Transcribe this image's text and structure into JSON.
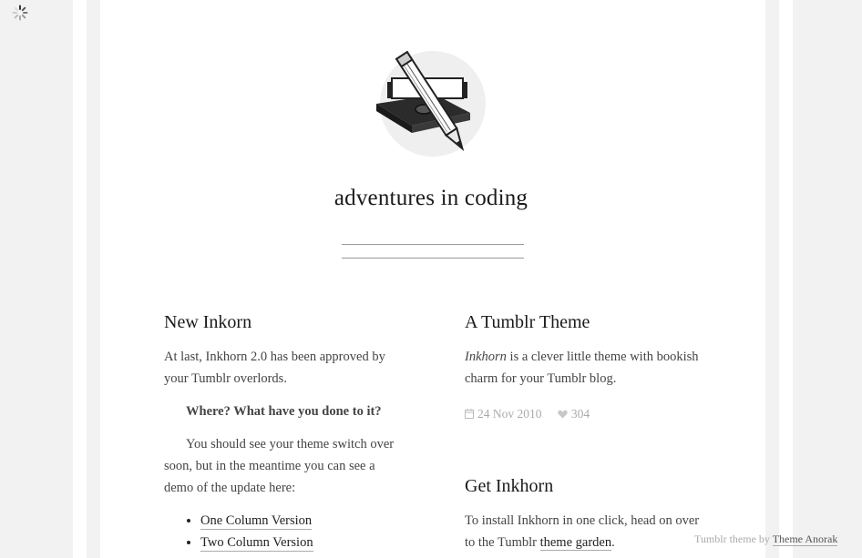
{
  "site": {
    "title": "adventures in coding"
  },
  "posts_left": {
    "title": "New Inkorn",
    "intro": "At last, Inkhorn 2.0 has been approved by your Tumblr overlords.",
    "subheading": "Where? What have you done to it?",
    "body": "You should see your theme switch over soon, but in the meantime you can see a demo of the update here:",
    "links": [
      "One Column Version",
      "Two Column Version"
    ]
  },
  "posts_right": [
    {
      "title": "A Tumblr Theme",
      "brand": "Inkhorn",
      "text_after_brand": " is a clever little theme with bookish charm for your Tumblr blog.",
      "date": "24 Nov 2010",
      "likes": "304"
    },
    {
      "title": "Get Inkhorn",
      "text_before_link": "To install Inkhorn in one click, head on over to the Tumblr ",
      "link": "theme garden",
      "text_after_link": "."
    }
  ],
  "footer": {
    "prefix": "Tumblr theme by ",
    "link": "Theme Anorak"
  },
  "colors": {
    "background": "#f2f2f2",
    "page": "#ffffff",
    "meta": "#aaaaaa",
    "logo_circle": "#efefef"
  },
  "icons": [
    "loading-spinner-icon",
    "inkhorn-logo",
    "calendar-icon",
    "heart-icon"
  ]
}
